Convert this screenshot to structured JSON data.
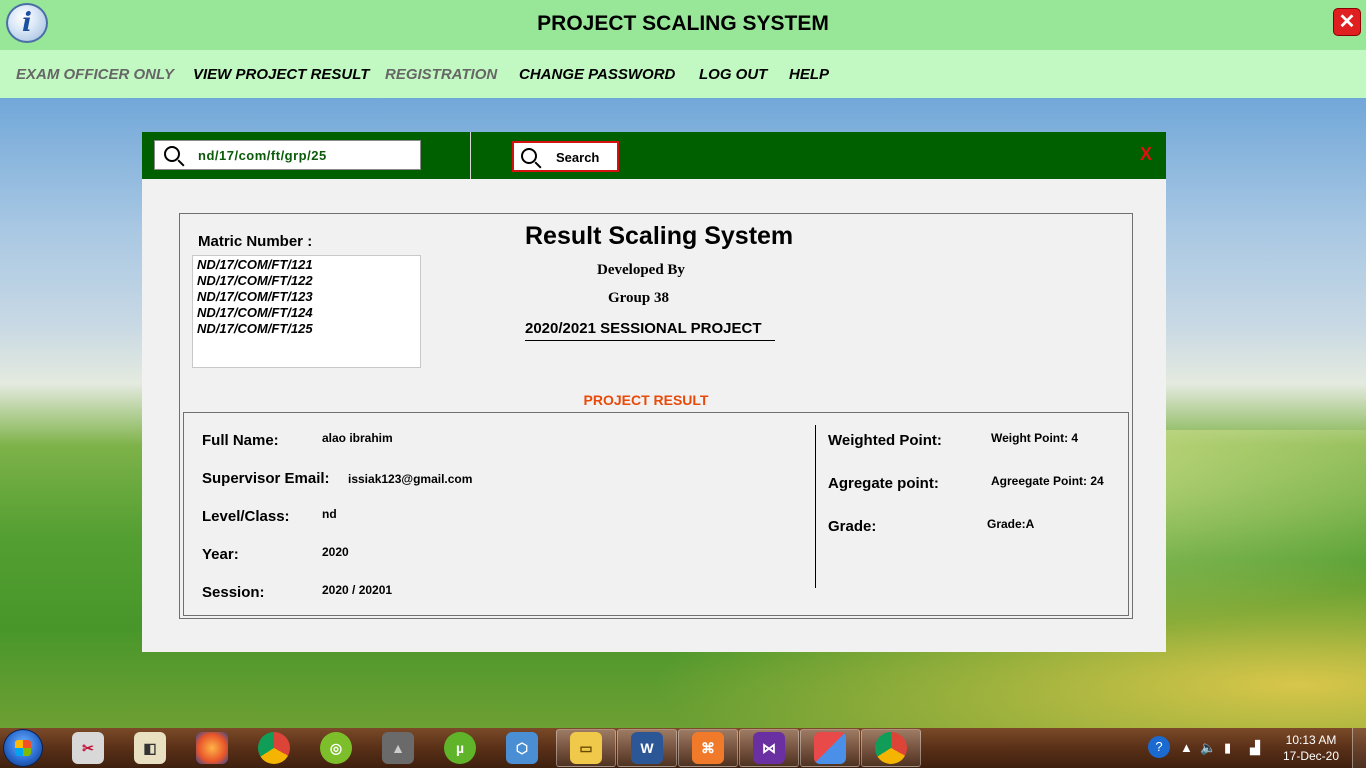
{
  "app": {
    "title": "PROJECT SCALING SYSTEM",
    "close_glyph": "✕",
    "info_glyph": "i"
  },
  "menu": {
    "items": [
      {
        "label": "EXAM OFFICER ONLY",
        "enabled": false
      },
      {
        "label": "VIEW PROJECT RESULT",
        "enabled": true
      },
      {
        "label": "REGISTRATION",
        "enabled": false
      },
      {
        "label": "CHANGE PASSWORD",
        "enabled": true
      },
      {
        "label": "LOG OUT",
        "enabled": true
      },
      {
        "label": "HELP",
        "enabled": true
      }
    ]
  },
  "search": {
    "value": "nd/17/com/ft/grp/25",
    "button_label": "Search",
    "close_label": "X"
  },
  "matric": {
    "label": "Matric Number :",
    "items": [
      "ND/17/COM/FT/121",
      "ND/17/COM/FT/122",
      "ND/17/COM/FT/123",
      "ND/17/COM/FT/124",
      "ND/17/COM/FT/125"
    ]
  },
  "header": {
    "title": "Result Scaling System",
    "developed_by": "Developed By",
    "group": "Group 38",
    "session": "2020/2021 SESSIONAL PROJECT"
  },
  "result": {
    "heading": "PROJECT RESULT",
    "full_name_label": "Full Name:",
    "full_name": "alao ibrahim",
    "supervisor_email_label": "Supervisor Email:",
    "supervisor_email": "issiak123@gmail.com",
    "level_label": "Level/Class:",
    "level": "nd",
    "year_label": "Year:",
    "year": "2020",
    "session_label": "Session:",
    "session": "2020 / 20201",
    "weighted_point_label": "Weighted Point:",
    "weighted_point": "Weight Point: 4",
    "aggregate_point_label": "Agregate point:",
    "aggregate_point": "Agreegate Point: 24",
    "grade_label": "Grade:",
    "grade": "Grade:A"
  },
  "taskbar": {
    "time": "10:13 AM",
    "date": "17-Dec-20",
    "apps": [
      "snipping-tool",
      "system-icon",
      "firefox",
      "chrome",
      "xampp-chameleon",
      "inkscape",
      "utorrent",
      "virtualbox",
      "file-explorer",
      "word",
      "xampp",
      "visual-studio",
      "control-panel",
      "chrome-active"
    ]
  },
  "colors": {
    "titlebar": "#98e698",
    "menubar": "#c2f9c2",
    "search_bar": "#006000",
    "accent_orange": "#e84a0a",
    "close_red": "#e02020"
  }
}
